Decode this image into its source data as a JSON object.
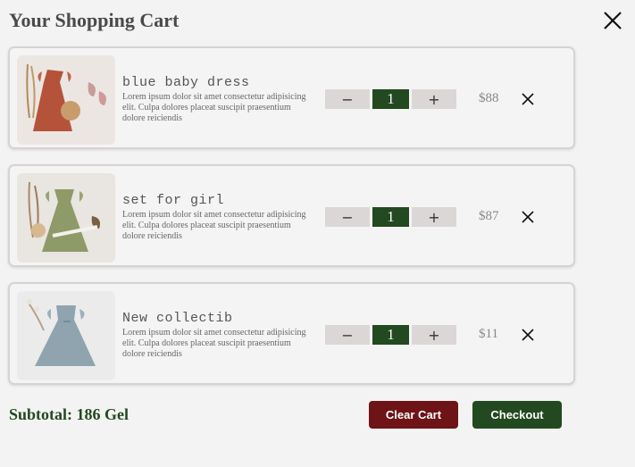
{
  "cart": {
    "title": "Your Shopping Cart",
    "items": [
      {
        "name": "blue baby dress",
        "description": "Lorem ipsum dolor sit amet consectetur adipisicing elit. Culpa dolores placeat suscipit praesentium dolore reiciendis",
        "quantity": "1",
        "price": "$88",
        "minus_label": "−",
        "plus_label": "+"
      },
      {
        "name": "set for girl",
        "description": "Lorem ipsum dolor sit amet consectetur adipisicing elit. Culpa dolores placeat suscipit praesentium dolore reiciendis",
        "quantity": "1",
        "price": "$87",
        "minus_label": "−",
        "plus_label": "+"
      },
      {
        "name": "New collectib",
        "description": "Lorem ipsum dolor sit amet consectetur adipisicing elit. Culpa dolores placeat suscipit praesentium dolore reiciendis",
        "quantity": "1",
        "price": "$11",
        "minus_label": "−",
        "plus_label": "+"
      }
    ],
    "subtotal": "Subtotal: 186 Gel",
    "clear_label": "Clear Cart",
    "checkout_label": "Checkout"
  },
  "colors": {
    "accent_green": "#22491f",
    "clear_red": "#6e1417",
    "background": "#f4f3f3"
  },
  "icons": {
    "close": "close-icon",
    "remove": "remove-icon"
  }
}
